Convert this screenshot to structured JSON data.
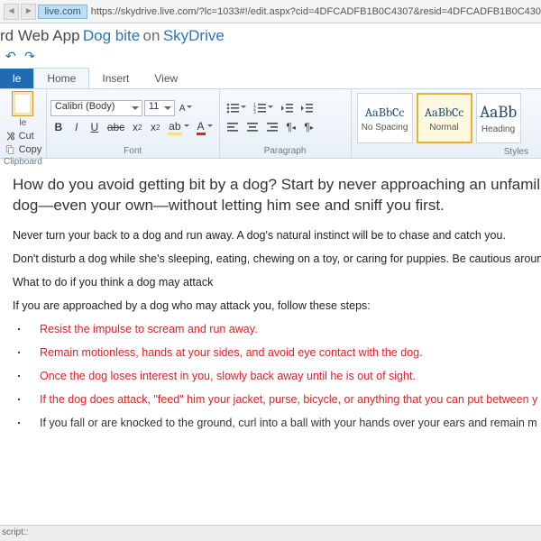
{
  "address": {
    "domain": "live.com",
    "url": "https://skydrive.live.com/?lc=1033#!/edit.aspx?cid=4DFCADFB1B0C4307&resid=4DFCADFB1B0C430"
  },
  "title": {
    "app_suffix": "rd Web App",
    "doc": "Dog bite",
    "on": "on",
    "service": "SkyDrive"
  },
  "tabs": {
    "file": "le",
    "home": "Home",
    "insert": "Insert",
    "view": "View"
  },
  "clipboard": {
    "cut": "Cut",
    "copy": "Copy",
    "label": "Clipboard",
    "paste": "le"
  },
  "font": {
    "name": "Calibri (Body)",
    "size": "11",
    "label": "Font"
  },
  "paragraph": {
    "label": "Paragraph"
  },
  "styles": {
    "label": "Styles",
    "items": [
      {
        "sample": "AaBbCc",
        "name": "No Spacing"
      },
      {
        "sample": "AaBbCc",
        "name": "Normal"
      },
      {
        "sample": "AaBb",
        "name": "Heading"
      }
    ]
  },
  "doc": {
    "intro_l1": "How do you avoid getting bit by a dog? Start by never approaching an unfamiliar do",
    "intro_l2": "dog—even your own—without letting him see and sniff you first.",
    "p1": "Never turn your back to a dog and run away. A dog's natural instinct will be to chase and catch you.",
    "p2": "Don't disturb a dog while she's sleeping, eating, chewing on a toy, or caring for puppies. Be cautious aroun",
    "p3": "What to do if you think a dog may attack",
    "p4": "If you are approached by a dog who may attack you, follow these steps:",
    "li1": "Resist the impulse to scream and run away.",
    "li2": "Remain motionless, hands at your sides, and avoid eye contact with the dog.",
    "li3": "Once the dog loses interest in you, slowly back away until he is out of sight.",
    "li4": "If the dog does attack, \"feed\" him your jacket, purse, bicycle, or anything that you can put between y",
    "li5": "If you fall or are knocked to the ground, curl into a ball with your hands over your ears and remain m"
  },
  "status": "script::"
}
